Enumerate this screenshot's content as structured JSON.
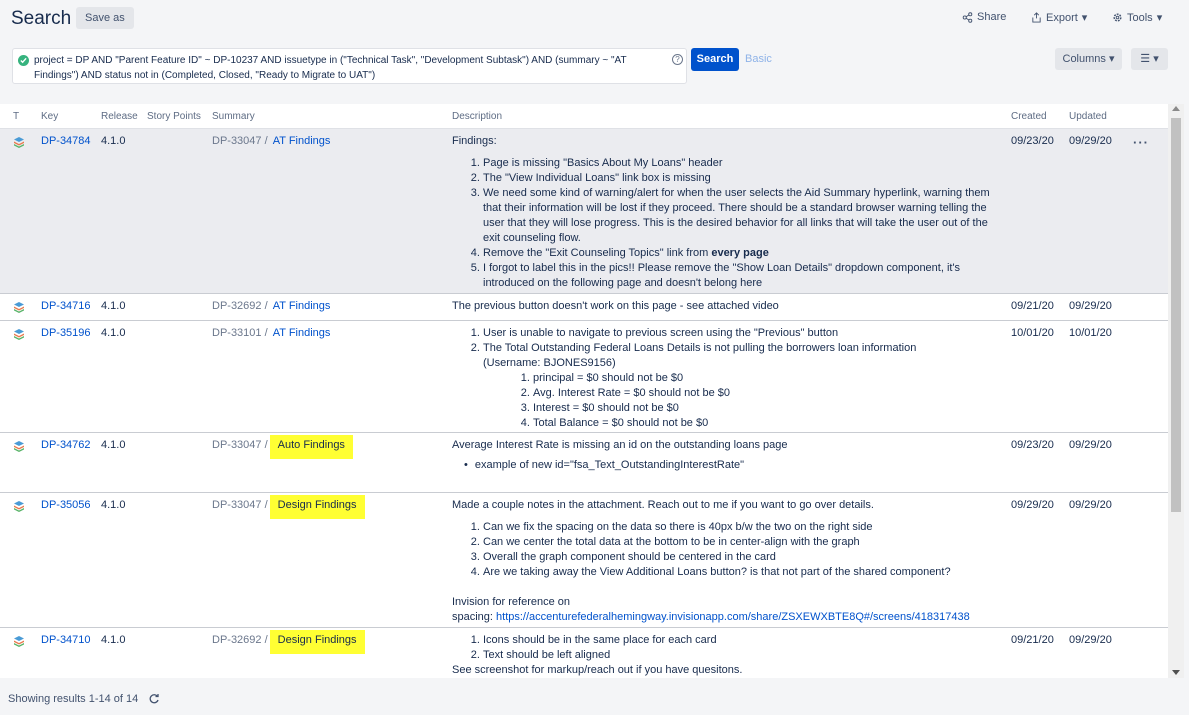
{
  "header": {
    "title": "Search",
    "save_as": "Save as",
    "share": "Share",
    "export": "Export",
    "tools": "Tools"
  },
  "query": {
    "text": "project = DP AND \"Parent Feature ID\" ~ DP-10237 AND issuetype in (\"Technical Task\", \"Development Subtask\") AND (summary ~ \"AT Findings\")  AND status not in (Completed, Closed, \"Ready to Migrate to UAT\")",
    "help": "?",
    "search_label": "Search",
    "basic_label": "Basic",
    "columns_label": "Columns"
  },
  "columns": {
    "t": "T",
    "key": "Key",
    "release": "Release",
    "story_points": "Story Points",
    "summary": "Summary",
    "description": "Description",
    "created": "Created",
    "updated": "Updated"
  },
  "rows": [
    {
      "key": "DP-34784",
      "release": "4.1.0",
      "parent": "DP-33047",
      "summary": "AT Findings",
      "created": "09/23/20",
      "updated": "09/29/20",
      "desc": {
        "intro": "Findings:",
        "items": [
          "Page is missing \"Basics About My Loans\" header",
          "The \"View Individual Loans\" link box is missing",
          "We need some kind of warning/alert for when the user selects the Aid Summary hyperlink, warning them that their information will be lost if they proceed. There should be a standard browser warning telling the user that they will lose progress. This is the desired behavior for all links that will take the user out of the exit counseling flow.",
          "Remove the \"Exit Counseling Topics\" link from ",
          "I forgot to label this in the pics!! Please remove the \"Show Loan Details\" dropdown component, it's introduced on the following page and doesn't belong here"
        ],
        "bold": "every page"
      }
    },
    {
      "key": "DP-34716",
      "release": "4.1.0",
      "parent": "DP-32692",
      "summary": "AT Findings",
      "created": "09/21/20",
      "updated": "09/29/20",
      "desc": {
        "text": "The previous button doesn't work on this page - see attached video"
      }
    },
    {
      "key": "DP-35196",
      "release": "4.1.0",
      "parent": "DP-33101",
      "summary": "AT Findings",
      "created": "10/01/20",
      "updated": "10/01/20",
      "desc": {
        "item1": "User is unable to navigate to previous screen using the \"Previous\" button",
        "item2": "The Total Outstanding Federal Loans Details is not pulling the borrowers loan information (Username: BJONES9156)",
        "sub": [
          "principal = $0 should not be $0",
          "Avg. Interest Rate = $0 should not be $0",
          "Interest = $0 should not be $0",
          "Total Balance = $0 should not be $0"
        ]
      }
    },
    {
      "key": "DP-34762",
      "release": "4.1.0",
      "parent": "DP-33047",
      "summary": "Auto Findings",
      "created": "09/23/20",
      "updated": "09/29/20",
      "desc": {
        "text": "Average Interest Rate is missing an id  on the outstanding loans page",
        "bullet": "example of new id=\"fsa_Text_OutstandingInterestRate\""
      }
    },
    {
      "key": "DP-35056",
      "release": "4.1.0",
      "parent": "DP-33047",
      "summary": "Design Findings",
      "created": "09/29/20",
      "updated": "09/29/20",
      "desc": {
        "intro": "Made a couple notes in the attachment. Reach out to me if you want to go over details.",
        "items": [
          "Can we fix the spacing on the data so there is 40px b/w the two on the right side",
          "Can we center the total data at the bottom to be in center-align with the graph",
          "Overall the graph component should be centered in the card",
          "Are we taking away the View Additional Loans button? is that not part of the shared component?"
        ],
        "ref1": "Invision for reference on",
        "ref2": "spacing: ",
        "link": "https://accenturefederalhemingway.invisionapp.com/share/ZSXEWXBTE8Q#/screens/418317438"
      }
    },
    {
      "key": "DP-34710",
      "release": "4.1.0",
      "parent": "DP-32692",
      "summary": "Design Findings",
      "created": "09/21/20",
      "updated": "09/29/20",
      "desc": {
        "items": [
          "Icons should be in the same place for each card",
          "Text should be left aligned"
        ],
        "after": "See screenshot for markup/reach out if you have quesitons."
      }
    }
  ],
  "footer": {
    "results": "Showing results 1-14 of 14"
  },
  "colors": {
    "accent": "#0052cc",
    "highlight": "#ffff33"
  }
}
